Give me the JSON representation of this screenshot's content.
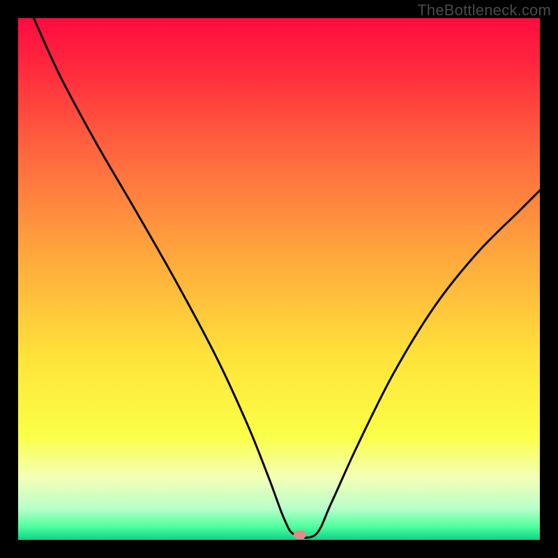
{
  "watermark": "TheBottleneck.com",
  "chart_data": {
    "type": "line",
    "title": "",
    "xlabel": "",
    "ylabel": "",
    "xlim": [
      0,
      100
    ],
    "ylim": [
      0,
      100
    ],
    "grid": false,
    "legend": false,
    "marker": {
      "x": 54,
      "y": 1,
      "color": "#e48a8a"
    },
    "series": [
      {
        "name": "curve",
        "color": "#000000",
        "x": [
          3,
          8,
          15,
          22,
          30,
          38,
          44,
          48,
          51,
          53,
          57,
          60,
          65,
          72,
          80,
          88,
          96,
          100
        ],
        "y": [
          100,
          89,
          76,
          64,
          50,
          35,
          22,
          12,
          4,
          1,
          1,
          7,
          18,
          32,
          45,
          55,
          63,
          67
        ]
      }
    ],
    "background_gradient": {
      "stops": [
        {
          "offset": 0.0,
          "color": "#ff0b3f"
        },
        {
          "offset": 0.1,
          "color": "#ff2b3d"
        },
        {
          "offset": 0.25,
          "color": "#ff643f"
        },
        {
          "offset": 0.45,
          "color": "#ffa63d"
        },
        {
          "offset": 0.65,
          "color": "#ffe33a"
        },
        {
          "offset": 0.8,
          "color": "#fbff46"
        },
        {
          "offset": 0.88,
          "color": "#f4ffb8"
        },
        {
          "offset": 0.94,
          "color": "#b8ffc9"
        },
        {
          "offset": 0.975,
          "color": "#4eff9e"
        },
        {
          "offset": 1.0,
          "color": "#0cd18a"
        }
      ]
    }
  }
}
